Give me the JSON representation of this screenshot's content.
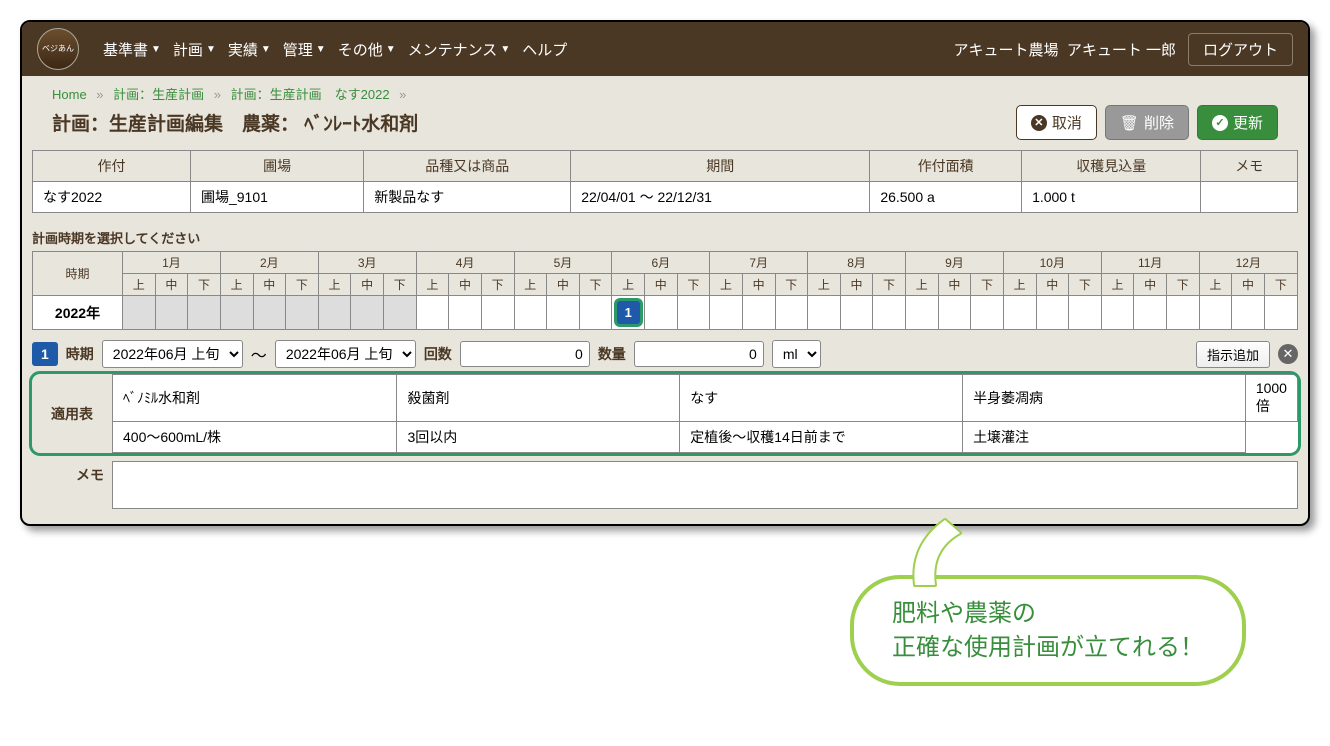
{
  "header": {
    "logo_text": "ベジあん",
    "menu": [
      "基準書",
      "計画",
      "実績",
      "管理",
      "その他",
      "メンテナンス",
      "ヘルプ"
    ],
    "farm": "アキュート農場",
    "user": "アキュート 一郎",
    "logout": "ログアウト"
  },
  "breadcrumb": {
    "items": [
      "Home",
      "計画：生産計画",
      "計画：生産計画　なす2022"
    ],
    "sep": "»"
  },
  "title": "計画：生産計画編集　農薬： ﾍﾞﾝﾚｰﾄ水和剤",
  "actions": {
    "cancel": "取消",
    "delete": "削除",
    "update": "更新"
  },
  "summary": {
    "headers": [
      "作付",
      "圃場",
      "品種又は商品",
      "期間",
      "作付面積",
      "収穫見込量",
      "メモ"
    ],
    "row": [
      "なす2022",
      "圃場_9101",
      "新製品なす",
      "22/04/01 ～ 22/12/31",
      "26.500 a",
      "1.000 t",
      ""
    ]
  },
  "cal_label": "計画時期を選択してください",
  "cal": {
    "period_head": "時期",
    "year": "2022年",
    "months": [
      "1月",
      "2月",
      "3月",
      "4月",
      "5月",
      "6月",
      "7月",
      "8月",
      "9月",
      "10月",
      "11月",
      "12月"
    ],
    "sub": [
      "上",
      "中",
      "下"
    ],
    "marker": "1",
    "marker_index": 15
  },
  "detail": {
    "badge": "1",
    "period_label": "時期",
    "from": "2022年06月 上旬",
    "tilde": "～",
    "to": "2022年06月 上旬",
    "count_label": "回数",
    "count_value": "0",
    "qty_label": "数量",
    "qty_value": "0",
    "unit": "ml",
    "add": "指示追加"
  },
  "apply": {
    "label": "適用表",
    "rows": [
      [
        "ﾍﾞﾉﾐﾙ水和剤",
        "殺菌剤",
        "なす",
        "半身萎凋病",
        "1000倍"
      ],
      [
        "400～600mL/株",
        "3回以内",
        "定植後～収穫14日前まで",
        "土壌灌注"
      ]
    ]
  },
  "memo_label": "メモ",
  "speech": "肥料や農薬の\n正確な使用計画が立てれる！"
}
